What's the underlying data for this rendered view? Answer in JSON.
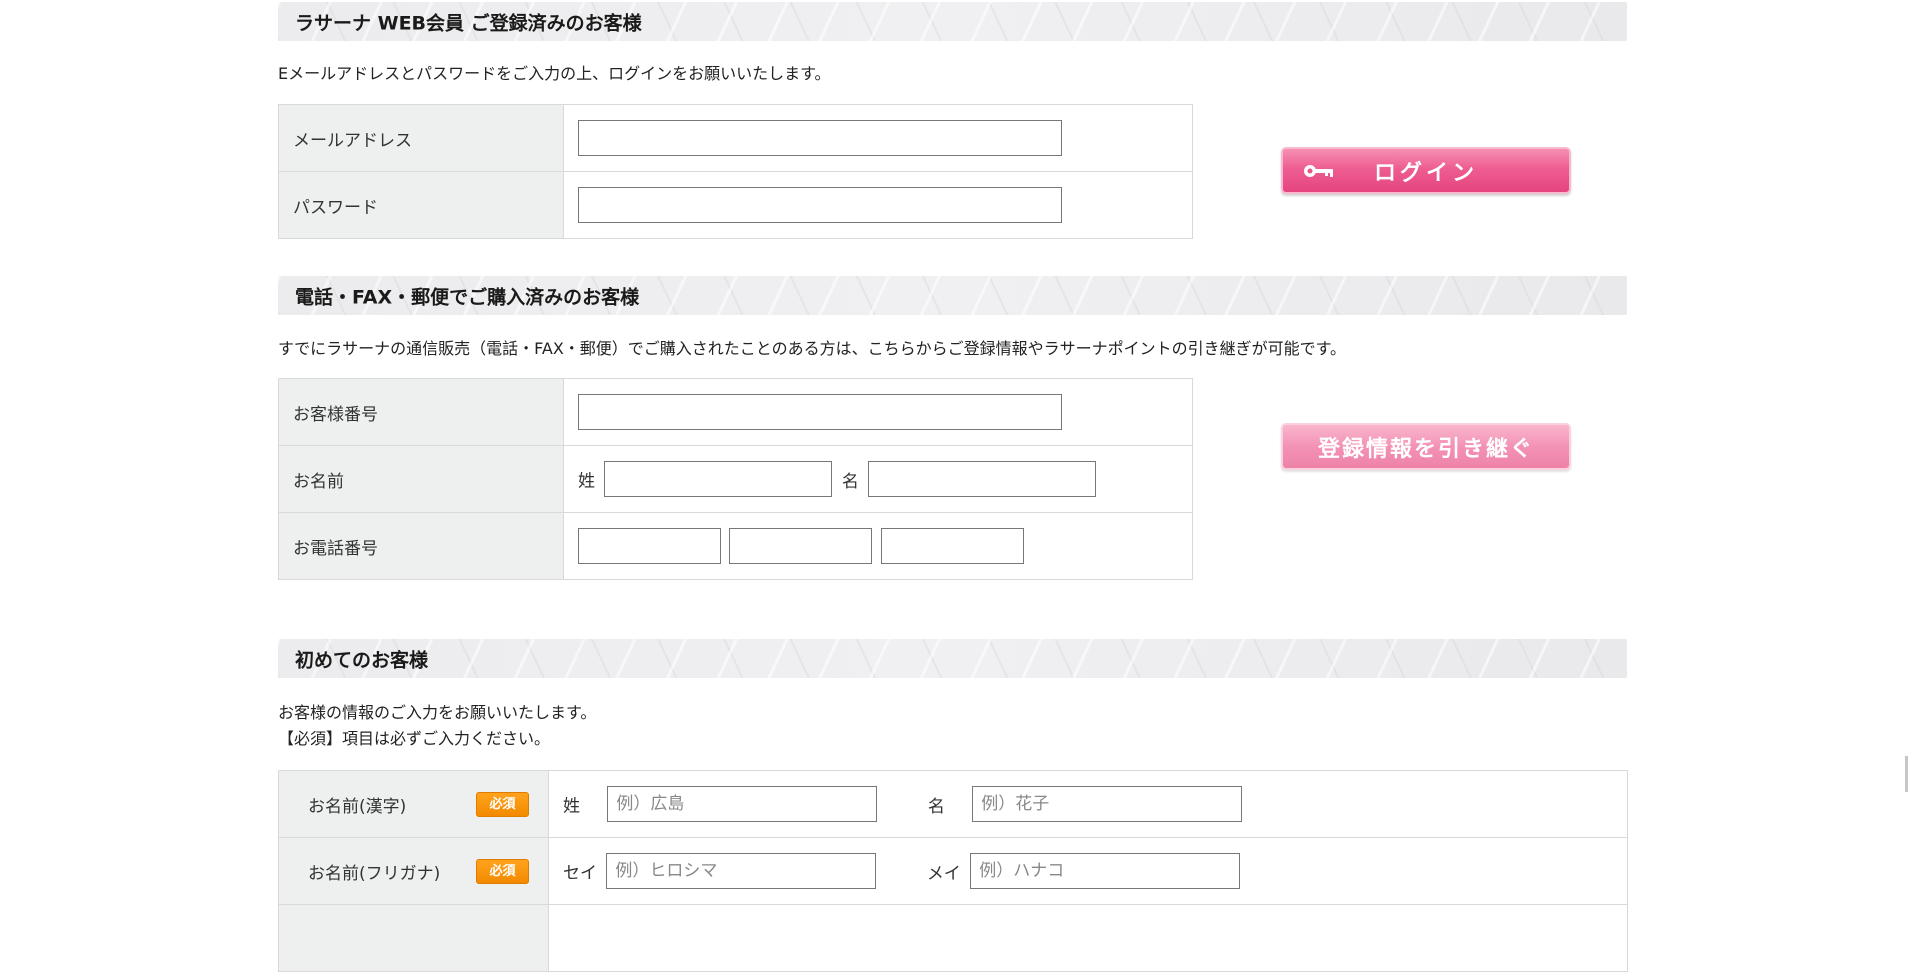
{
  "login_section": {
    "heading": "ラサーナ WEB会員 ご登録済みのお客様",
    "description": "Eメールアドレスとパスワードをご入力の上、ログインをお願いいたします。",
    "email_label": "メールアドレス",
    "password_label": "パスワード",
    "login_button": "ログイン"
  },
  "takeover_section": {
    "heading": "電話・FAX・郵便でご購入済みのお客様",
    "description": "すでにラサーナの通信販売（電話・FAX・郵便）でご購入されたことのある方は、こちらからご登録情報やラサーナポイントの引き継ぎが可能です。",
    "customer_no_label": "お客様番号",
    "name_label": "お名前",
    "sei_prefix": "姓",
    "mei_prefix": "名",
    "phone_label": "お電話番号",
    "takeover_button": "登録情報を引き継ぐ"
  },
  "new_section": {
    "heading": "初めてのお客様",
    "description_1": "お客様の情報のご入力をお願いいたします。",
    "description_2": "【必須】項目は必ずご入力ください。",
    "required_badge": "必須",
    "kanji_label": "お名前(漢字)",
    "kanji_sei_prefix": "姓",
    "kanji_sei_placeholder": "例）広島",
    "kanji_mei_prefix": "名",
    "kanji_mei_placeholder": "例）花子",
    "kana_label": "お名前(フリガナ)",
    "kana_sei_prefix": "セイ",
    "kana_sei_placeholder": "例）ヒロシマ",
    "kana_mei_prefix": "メイ",
    "kana_mei_placeholder": "例）ハナコ"
  }
}
